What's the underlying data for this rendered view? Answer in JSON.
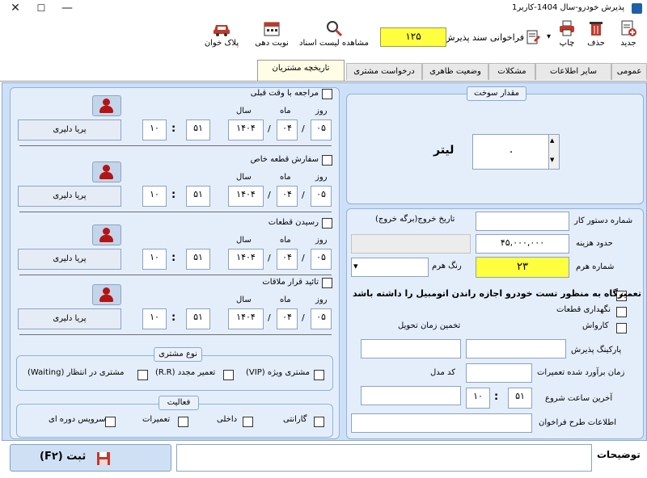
{
  "window": {
    "title": "پذیرش خودرو-سال 1404-کاربر1",
    "minimize": "—",
    "maximize": "☐",
    "close": "✕"
  },
  "toolbar": {
    "new_label": "جدید",
    "delete_label": "حذف",
    "print_label": "چاپ",
    "recall_label": "فراخوانی سند پذیرش",
    "doc_number": "۱۲۵",
    "view_list_label": "مشاهده لیست اسناد",
    "turn_label": "نوبت دهی",
    "plate_reader_label": "پلاک خوان",
    "dropdown_arrow": "▾"
  },
  "tabs": [
    {
      "label": "عمومی",
      "active": false
    },
    {
      "label": "سایر اطلاعات",
      "active": false
    },
    {
      "label": "مشکلات",
      "active": false
    },
    {
      "label": "وضعیت ظاهری",
      "active": false
    },
    {
      "label": "درخواست مشتری",
      "active": false
    },
    {
      "label": "تاریخچه مشتریان",
      "active": true
    }
  ],
  "fuel": {
    "title": "مقدار سوخت",
    "value": "۰",
    "unit": "لیتر",
    "spin_up": "▲",
    "spin_down": "▼"
  },
  "details": {
    "exit_date_label": "تاریخ خروج(برگه خروج)",
    "work_order_label": "شماره دستور کار",
    "work_order_value": "",
    "cost_limit_label": "حدود هزینه",
    "cost_limit_value": "۴۵,۰۰۰,۰۰۰",
    "hash_color_label": "رنگ هرم",
    "hash_number_label": "شماره هرم",
    "hash_number_value": "۲۳",
    "combo_arrow": "▾",
    "test_drive_label": "تعمیرگاه به منظور تست خودرو اجازه راندن اتومبیل را داشته باشد",
    "test_drive_checked": true,
    "keep_parts_label": "نگهداری قطعات",
    "keep_parts_checked": false,
    "carwash_label": "کارواش",
    "carwash_checked": false,
    "estimate_delivery_label": "تخمین زمان تحویل",
    "parking_label": "پارکینگ پذیرش",
    "estimated_repair_label": "زمان برآورد شده تعمیرات",
    "model_code_label": "کد مدل",
    "last_start_label": "آخرین ساعت شروع",
    "last_start_hour": "۱۰",
    "last_start_minute": "۵۱",
    "recall_plan_label": "اطلاعات طرح فراخوان",
    "check_mark": "✓"
  },
  "history": [
    {
      "label": "مراجعه با وقت قبلی",
      "day": "۰۵",
      "month": "۰۴",
      "year": "۱۴۰۴",
      "minute": "۵۱",
      "hour": "۱۰",
      "user": "پریا دلیری"
    },
    {
      "label": "سفارش قطعه خاص",
      "day": "۰۵",
      "month": "۰۴",
      "year": "۱۴۰۴",
      "minute": "۵۱",
      "hour": "۱۰",
      "user": "پریا دلیری"
    },
    {
      "label": "رسیدن قطعات",
      "day": "۰۵",
      "month": "۰۴",
      "year": "۱۴۰۴",
      "minute": "۵۱",
      "hour": "۱۰",
      "user": "پریا دلیری"
    },
    {
      "label": "تائید قرار ملاقات",
      "day": "۰۵",
      "month": "۰۴",
      "year": "۱۴۰۴",
      "minute": "۵۱",
      "hour": "۱۰",
      "user": "پریا دلیری"
    }
  ],
  "date_labels": {
    "day": "روز",
    "month": "ماه",
    "year": "سال",
    "slash": "/",
    "colon": ":"
  },
  "customer_type": {
    "title": "نوع مشتری",
    "vip": "مشتری ویژه (VIP)",
    "rr": "تعمیر مجدد (R.R)",
    "waiting": "مشتری در انتظار (Waiting)"
  },
  "activity": {
    "title": "فعالیت",
    "warranty": "گارانتی",
    "internal": "داخلی",
    "repairs": "تعمیرات",
    "periodic": "سرویس دوره ای"
  },
  "footer": {
    "save_label": "ثبت (F۲)",
    "notes_label": "توضیحات",
    "notes_value": ""
  }
}
